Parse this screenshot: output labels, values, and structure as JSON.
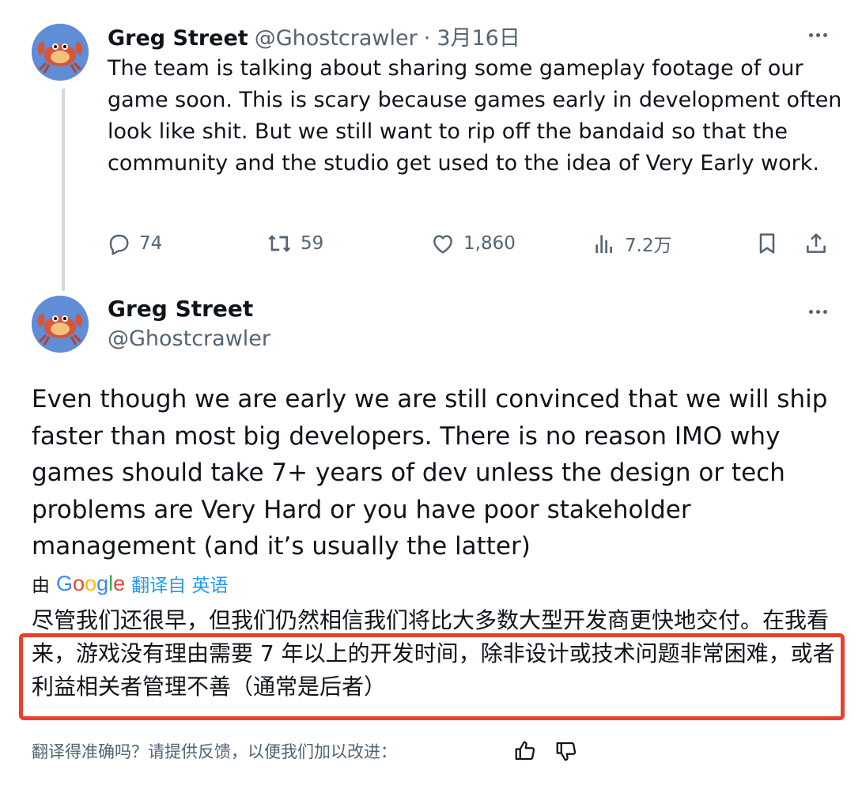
{
  "tweet1": {
    "author_name": "Greg Street",
    "author_handle": "@Ghostcrawler",
    "separator": "·",
    "date": "3月16日",
    "text": "The team is talking about sharing some gameplay footage of our game soon. This is scary because games early in development often look like shit. But we still want to rip off the bandaid so that the community and the studio get used to the idea of Very Early work.",
    "actions": {
      "replies": "74",
      "reposts": "59",
      "likes": "1,860",
      "views": "7.2万"
    }
  },
  "tweet2": {
    "author_name": "Greg Street",
    "author_handle": "@Ghostcrawler",
    "text": "Even though we are early we are still convinced that we will ship faster than most big developers. There is no reason IMO why games should take 7+ years of dev unless the design or tech problems are Very Hard or you have poor stakeholder management (and it’s usually the latter)",
    "translation": {
      "by_prefix": "由",
      "google_letters": [
        "G",
        "o",
        "o",
        "g",
        "l",
        "e"
      ],
      "translated_from_label": "翻译自 英语",
      "text": "尽管我们还很早，但我们仍然相信我们将比大多数大型开发商更快地交付。在我看来，游戏没有理由需要 7 年以上的开发时间，除非设计或技术问题非常困难，或者利益相关者管理不善（通常是后者）",
      "feedback_prompt": "翻译得准确吗？请提供反馈，以便我们加以改进："
    }
  },
  "colors": {
    "text_primary": "#0f1419",
    "text_secondary": "#536471",
    "link": "#1d9bf0",
    "highlight_border": "#e8412e",
    "google_blue": "#4285f4",
    "google_red": "#ea4335",
    "google_yellow": "#fbbc05",
    "google_green": "#34a853"
  },
  "icons": [
    "avatar-crab",
    "more-icon",
    "reply-icon",
    "repost-icon",
    "like-icon",
    "views-icon",
    "bookmark-icon",
    "share-icon",
    "thumbs-up-icon",
    "thumbs-down-icon"
  ]
}
